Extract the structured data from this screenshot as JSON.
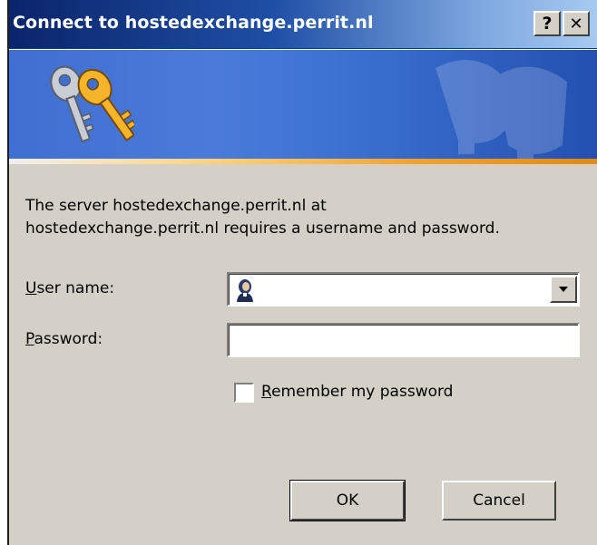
{
  "window": {
    "title": "Connect to hostedexchange.perrit.nl",
    "help_label": "?",
    "close_label": "✕"
  },
  "message": {
    "line1": "The server hostedexchange.perrit.nl at",
    "line2": "hostedexchange.perrit.nl requires a username and password."
  },
  "form": {
    "username_label_mnemonic": "U",
    "username_label_rest": "ser name:",
    "username_value": "",
    "password_label_mnemonic": "P",
    "password_label_rest": "assword:",
    "password_value": "",
    "remember_mnemonic": "R",
    "remember_rest": "emember my password",
    "remember_checked": false
  },
  "buttons": {
    "ok": "OK",
    "cancel": "Cancel"
  },
  "colors": {
    "titlebar_start": "#0a246a",
    "titlebar_end": "#a6caf0",
    "dialog_bg": "#d4d0c8",
    "banner_blue": "#3f6fd0",
    "banner_line_orange": "#f3a12a"
  },
  "icons": [
    "keys-icon",
    "key-watermark-icon",
    "user-icon",
    "chevron-down-icon",
    "help-icon",
    "close-icon"
  ]
}
